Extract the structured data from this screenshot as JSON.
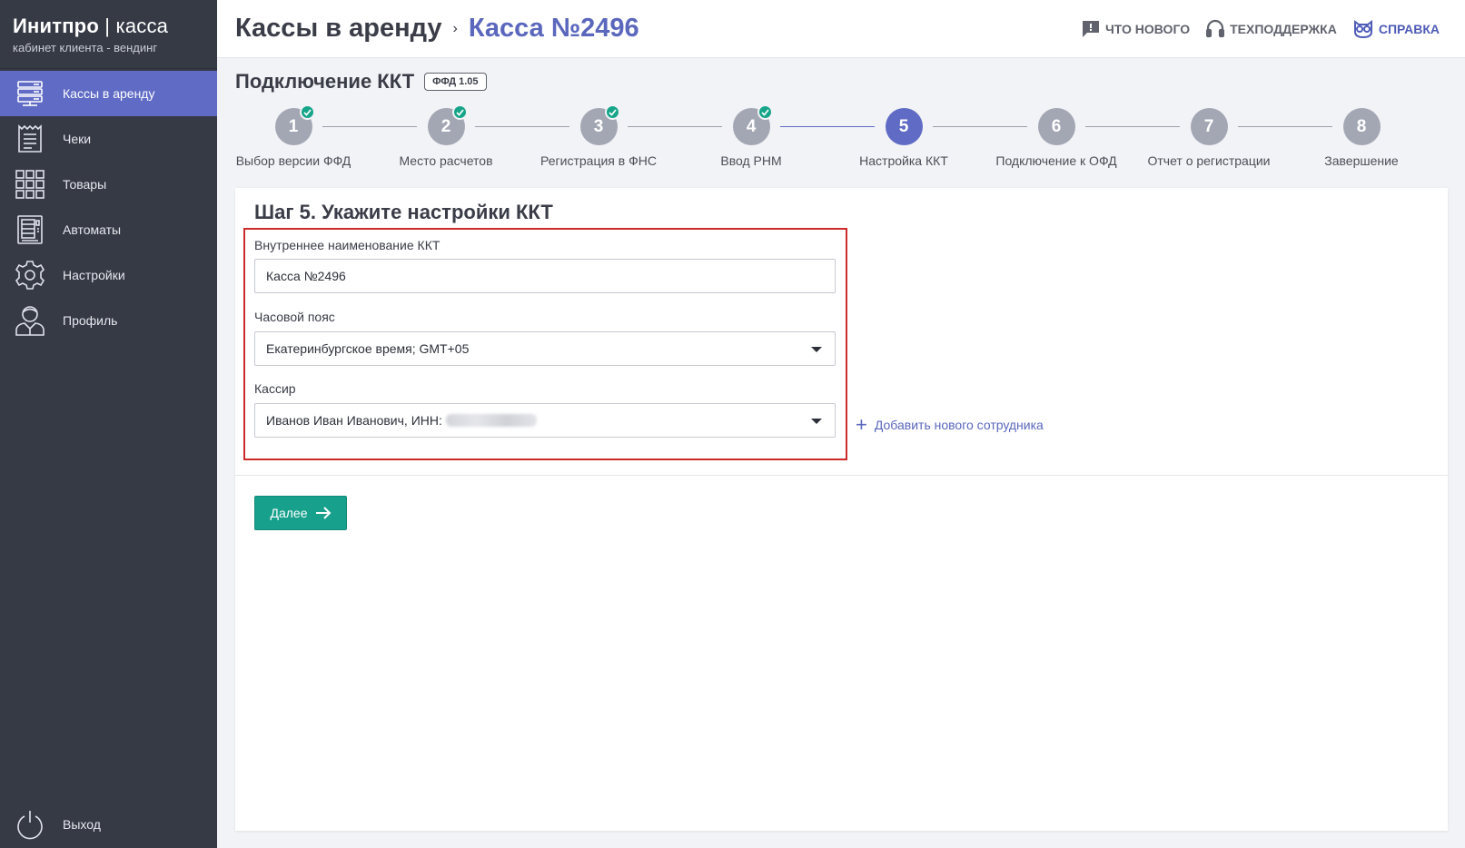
{
  "brand": {
    "title_bold": "Инитпро",
    "title_sep": " | ",
    "title_light": "касса",
    "subtitle": "кабинет клиента - вендинг"
  },
  "sidebar": {
    "items": [
      {
        "label": "Кассы в аренду",
        "icon": "server-icon",
        "active": true
      },
      {
        "label": "Чеки",
        "icon": "receipt-icon",
        "active": false
      },
      {
        "label": "Товары",
        "icon": "grid-icon",
        "active": false
      },
      {
        "label": "Автоматы",
        "icon": "vending-machine-icon",
        "active": false
      },
      {
        "label": "Настройки",
        "icon": "gear-icon",
        "active": false
      },
      {
        "label": "Профиль",
        "icon": "user-icon",
        "active": false
      }
    ],
    "logout_label": "Выход"
  },
  "header": {
    "crumb_root": "Кассы в аренду",
    "crumb_sep": "›",
    "crumb_current": "Касса №2496",
    "links": {
      "whats_new": "Что нового",
      "support": "Техподдержка",
      "help": "Справка"
    }
  },
  "section": {
    "title": "Подключение ККТ",
    "badge": "ФФД 1.05"
  },
  "stepper": {
    "steps": [
      {
        "num": "1",
        "label": "Выбор версии ФФД",
        "status": "done"
      },
      {
        "num": "2",
        "label": "Место расчетов",
        "status": "done"
      },
      {
        "num": "3",
        "label": "Регистрация в ФНС",
        "status": "done"
      },
      {
        "num": "4",
        "label": "Ввод РНМ",
        "status": "done"
      },
      {
        "num": "5",
        "label": "Настройка ККТ",
        "status": "current"
      },
      {
        "num": "6",
        "label": "Подключение к ОФД",
        "status": "pending"
      },
      {
        "num": "7",
        "label": "Отчет о регистрации",
        "status": "pending"
      },
      {
        "num": "8",
        "label": "Завершение",
        "status": "pending"
      }
    ]
  },
  "form": {
    "title": "Шаг 5. Укажите настройки ККТ",
    "name_label": "Внутреннее наименование ККТ",
    "name_value": "Касса №2496",
    "tz_label": "Часовой пояс",
    "tz_value": "Екатеринбургское время; GMT+05",
    "cashier_label": "Кассир",
    "cashier_value": "Иванов Иван Иванович, ИНН:",
    "add_employee": "Добавить нового сотрудника",
    "next_label": "Далее"
  },
  "colors": {
    "accent": "#5f6bc4",
    "sidebar": "#363a45",
    "success": "#17a08c",
    "highlight": "#cc2b2b"
  }
}
